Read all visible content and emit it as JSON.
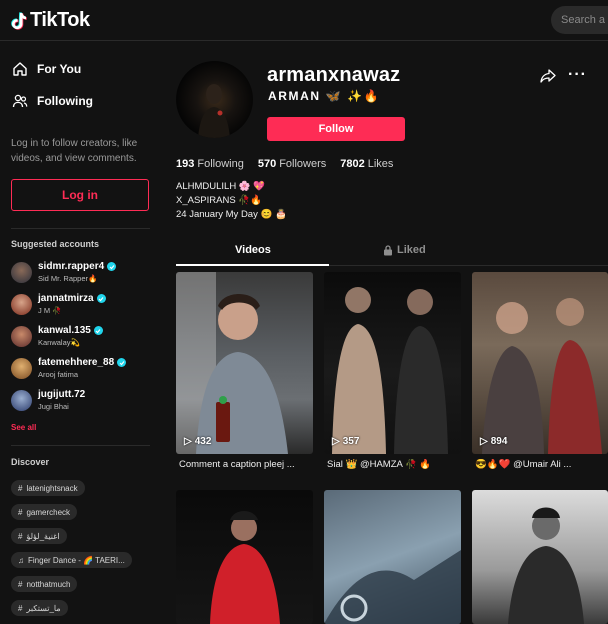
{
  "header": {
    "logo_text": "TikTok",
    "search_placeholder": "Search a"
  },
  "sidebar": {
    "nav": [
      {
        "label": "For You",
        "icon": "home-icon"
      },
      {
        "label": "Following",
        "icon": "people-icon"
      }
    ],
    "login_hint": "Log in to follow creators, like videos, and view comments.",
    "login_label": "Log in",
    "suggested_title": "Suggested accounts",
    "accounts": [
      {
        "username": "sidmr.rapper4",
        "name": "Sid Mr. Rapper🔥",
        "verified": true
      },
      {
        "username": "jannatmirza",
        "name": "J M 🥀",
        "verified": true
      },
      {
        "username": "kanwal.135",
        "name": "Kanwalay💫",
        "verified": true
      },
      {
        "username": "fatemehhere_88",
        "name": "Arooj fatima",
        "verified": true
      },
      {
        "username": "jugijutt.72",
        "name": "Jugi Bhai",
        "verified": false
      }
    ],
    "see_all": "See all",
    "discover_title": "Discover",
    "discover": [
      {
        "label": "latenightsnack",
        "type": "hashtag"
      },
      {
        "label": "gamercheck",
        "type": "hashtag"
      },
      {
        "label": "اغنية_لؤلؤ",
        "type": "hashtag"
      },
      {
        "label": "Finger Dance - 🌈 TAERI...",
        "type": "music"
      },
      {
        "label": "notthatmuch",
        "type": "hashtag"
      },
      {
        "label": "ما_تستكبر",
        "type": "hashtag"
      }
    ]
  },
  "profile": {
    "username": "armanxnawaz",
    "nickname": "ARMAN 🦋 ✨🔥",
    "follow_label": "Follow",
    "following_count": "193",
    "following_label": "Following",
    "followers_count": "570",
    "followers_label": "Followers",
    "likes_count": "7802",
    "likes_label": "Likes",
    "bio": [
      "ALHMDULILH 🌸 💖",
      "X_ASPIRANS 🥀🔥",
      "24 January My Day 😊 🎂"
    ]
  },
  "tabs": {
    "videos": "Videos",
    "liked": "Liked"
  },
  "videos": [
    {
      "views": "432",
      "caption": "Comment a caption pleej ..."
    },
    {
      "views": "357",
      "caption": "Sial 👑 @HAMZA 🥀 🔥"
    },
    {
      "views": "894",
      "caption": "😎🔥❤️ @Umair Ali ..."
    },
    {
      "views": "",
      "caption": ""
    },
    {
      "views": "",
      "caption": ""
    },
    {
      "views": "",
      "caption": ""
    }
  ],
  "colors": {
    "accent": "#fe2c55",
    "verified": "#20d5ec",
    "background": "#121212"
  }
}
